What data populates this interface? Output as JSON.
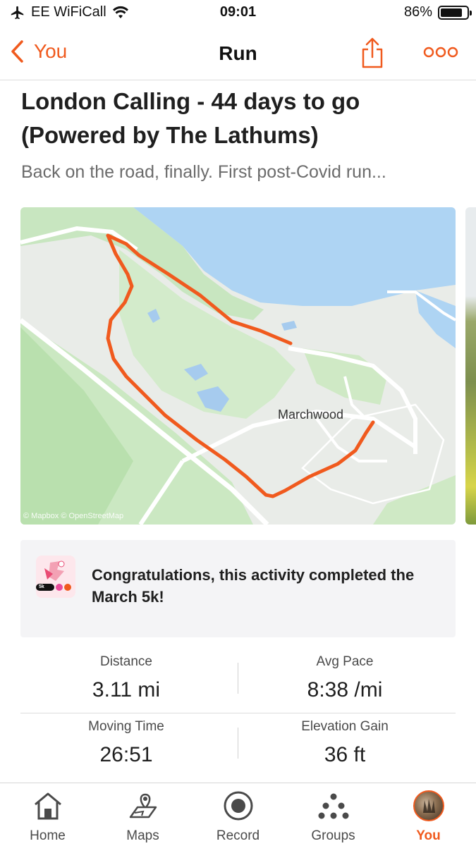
{
  "status_bar": {
    "carrier": "EE WiFiCall",
    "time": "09:01",
    "battery": "86%",
    "battery_level": 0.86
  },
  "nav": {
    "back_label": "You",
    "title": "Run",
    "share_icon": "share-icon",
    "more_icon": "more-icon"
  },
  "activity": {
    "title": "London Calling - 44 days to go (Powered by The Lathums)",
    "description": "Back on the road, finally. First post-Covid run..."
  },
  "map": {
    "place_label": "Marchwood",
    "attribution": "© Mapbox © OpenStreetMap",
    "route_color": "#f05a1e",
    "water_color": "#aed4f3",
    "park_color": "#c8e6c0"
  },
  "achievement": {
    "badge_text": "5k",
    "text": "Congratulations, this activity completed the March 5k!"
  },
  "stats": [
    {
      "label": "Distance",
      "value": "3.11 mi"
    },
    {
      "label": "Avg Pace",
      "value": "8:38 /mi"
    },
    {
      "label": "Moving Time",
      "value": "26:51"
    },
    {
      "label": "Elevation Gain",
      "value": "36 ft"
    }
  ],
  "tabs": [
    {
      "label": "Home",
      "icon": "home-icon",
      "active": false
    },
    {
      "label": "Maps",
      "icon": "maps-icon",
      "active": false
    },
    {
      "label": "Record",
      "icon": "record-icon",
      "active": false
    },
    {
      "label": "Groups",
      "icon": "groups-icon",
      "active": false
    },
    {
      "label": "You",
      "icon": "avatar",
      "active": true
    }
  ],
  "colors": {
    "accent": "#f05a1e",
    "text_primary": "#1f1f1f",
    "text_secondary": "#6b6b6b"
  }
}
